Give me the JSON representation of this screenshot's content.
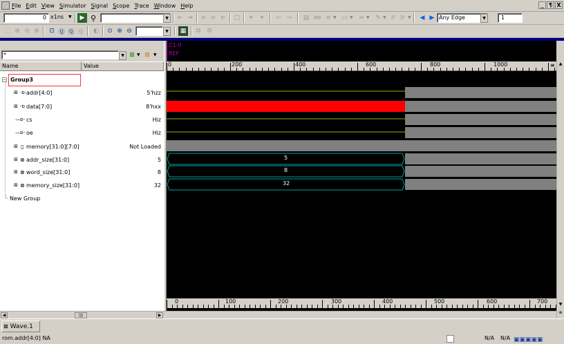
{
  "menubar": {
    "items": [
      "File",
      "Edit",
      "View",
      "Simulator",
      "Signal",
      "Scope",
      "Trace",
      "Window",
      "Help"
    ],
    "window_controls": [
      "_",
      "¶",
      "X"
    ]
  },
  "toolbar1": {
    "time_value": "0",
    "time_unit": "x1ns",
    "edge_select": "Any Edge",
    "edge_count": "1"
  },
  "leftpanel": {
    "filter_value": "*",
    "col_name": "Name",
    "col_value": "Value",
    "group": "Group3",
    "signals": [
      {
        "name": "addr[4:0]",
        "value": "5'hzz",
        "icon": "bus-input-icon"
      },
      {
        "name": "data[7:0]",
        "value": "8'hxx",
        "icon": "bus-inout-icon"
      },
      {
        "name": "cs",
        "value": "Hiz",
        "icon": "input-icon"
      },
      {
        "name": "oe",
        "value": "Hiz",
        "icon": "input-icon"
      },
      {
        "name": "memory[31:0][7:0]",
        "value": "Not Loaded",
        "icon": "memory-icon"
      },
      {
        "name": "addr_size[31:0]",
        "value": "5",
        "icon": "parameter-icon"
      },
      {
        "name": "word_size[31:0]",
        "value": "8",
        "icon": "parameter-icon"
      },
      {
        "name": "memory_size[31:0]",
        "value": "32",
        "icon": "parameter-icon"
      }
    ],
    "new_group": "New Group"
  },
  "cursor": {
    "label": "C1:0",
    "ref": "REF"
  },
  "ruler_top": {
    "ticks": [
      "0",
      "200",
      "400",
      "600",
      "800",
      "1000"
    ]
  },
  "ruler_bottom": {
    "ticks": [
      "0",
      "100",
      "200",
      "300",
      "400",
      "500",
      "600",
      "700"
    ]
  },
  "waves": {
    "param_values": [
      "5",
      "8",
      "32"
    ]
  },
  "colors": {
    "wave_bg": "#000000",
    "signal_line": "#a8a800",
    "undefined_red": "#ff0000",
    "unknown_gray": "#808080",
    "bus_outline": "#00a0a0",
    "selection_border": "#ff0000",
    "cursor_magenta": "#c000c0"
  },
  "tabs": {
    "active": "Wave.1",
    "close": "×"
  },
  "statusbar": {
    "left": "rom.addr[4:0] NA",
    "na1": "N/A",
    "na2": "N/A"
  }
}
